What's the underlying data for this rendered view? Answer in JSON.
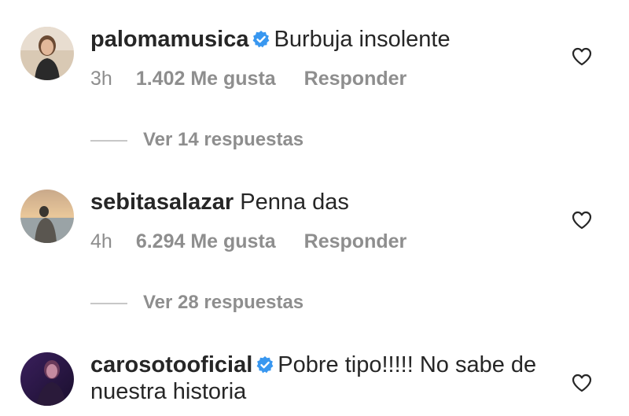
{
  "comments": [
    {
      "username": "palomamusica",
      "verified": true,
      "text": "Burbuja insolente",
      "time": "3h",
      "likes": "1.402 Me gusta",
      "reply": "Responder",
      "view_replies": "Ver 14 respuestas"
    },
    {
      "username": "sebitasalazar",
      "verified": false,
      "text": "Penna das",
      "time": "4h",
      "likes": "6.294 Me gusta",
      "reply": "Responder",
      "view_replies": "Ver 28 respuestas"
    },
    {
      "username": "carosotooficial",
      "verified": true,
      "text": "Pobre tipo!!!!! No sabe de nuestra historia"
    }
  ],
  "icons": {
    "verified": "verified-badge-icon",
    "like": "heart-outline-icon"
  },
  "colors": {
    "text_primary": "#262626",
    "text_secondary": "#8e8e8e",
    "verified_blue": "#3897f0",
    "divider": "#c7c7c7"
  }
}
